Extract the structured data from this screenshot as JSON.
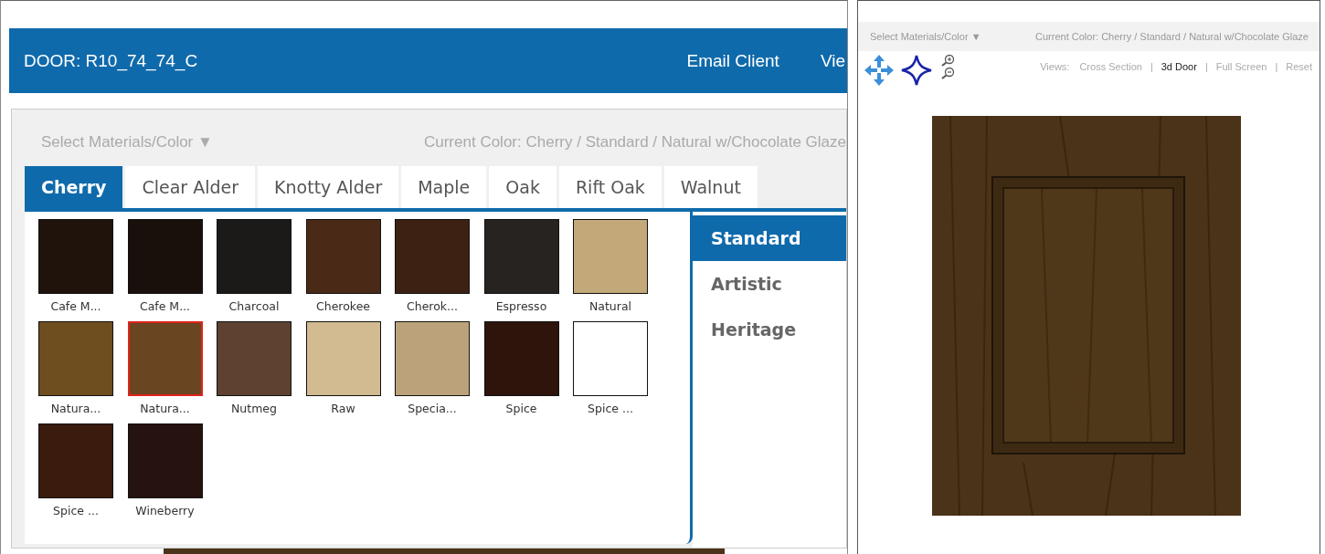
{
  "header": {
    "title": "DOOR: R10_74_74_C",
    "links": [
      "Email Client",
      "Vie"
    ]
  },
  "dialog": {
    "select_menu": "Select Materials/Color ▼",
    "current_color": "Current Color: Cherry / Standard / Natural w/Chocolate Glaze",
    "tabs": [
      {
        "label": "Cherry",
        "selected": true
      },
      {
        "label": "Clear Alder",
        "selected": false
      },
      {
        "label": "Knotty Alder",
        "selected": false
      },
      {
        "label": "Maple",
        "selected": false
      },
      {
        "label": "Oak",
        "selected": false
      },
      {
        "label": "Rift Oak",
        "selected": false
      },
      {
        "label": "Walnut",
        "selected": false
      }
    ],
    "swatches": [
      {
        "label": "Cafe M...",
        "color": "#1f130c",
        "selected": false
      },
      {
        "label": "Cafe M...",
        "color": "#1a100b",
        "selected": false
      },
      {
        "label": "Charcoal",
        "color": "#1c1a19",
        "selected": false
      },
      {
        "label": "Cherokee",
        "color": "#4a2a16",
        "selected": false
      },
      {
        "label": "Cherok...",
        "color": "#3d2112",
        "selected": false
      },
      {
        "label": "Espresso",
        "color": "#262321",
        "selected": false
      },
      {
        "label": "Natural",
        "color": "#c3a87a",
        "selected": false
      },
      {
        "label": "Natura...",
        "color": "#6e4e1e",
        "selected": false
      },
      {
        "label": "Natura...",
        "color": "#6a4522",
        "selected": true
      },
      {
        "label": "Nutmeg",
        "color": "#5e4130",
        "selected": false
      },
      {
        "label": "Raw",
        "color": "#d2ba91",
        "selected": false
      },
      {
        "label": "Specia...",
        "color": "#bca27a",
        "selected": false
      },
      {
        "label": "Spice",
        "color": "#2e140b",
        "selected": false
      },
      {
        "label": "Spice ...",
        "color": "#ffffff",
        "selected": false
      },
      {
        "label": "Spice ...",
        "color": "#3a1b0e",
        "selected": false
      },
      {
        "label": "Wineberry",
        "color": "#26120f",
        "selected": false
      }
    ],
    "finishes": [
      {
        "label": "Standard",
        "selected": true
      },
      {
        "label": "Artistic",
        "selected": false
      },
      {
        "label": "Heritage",
        "selected": false
      }
    ]
  },
  "preview": {
    "select_menu": "Select Materials/Color ▼",
    "current_color": "Current Color: Cherry / Standard / Natural w/Chocolate Glaze",
    "views_label": "Views:",
    "separator": "|",
    "views": [
      {
        "label": "Cross Section",
        "selected": false
      },
      {
        "label": "3d Door",
        "selected": true
      },
      {
        "label": "Full Screen",
        "selected": false
      },
      {
        "label": "Reset",
        "selected": false
      }
    ]
  }
}
